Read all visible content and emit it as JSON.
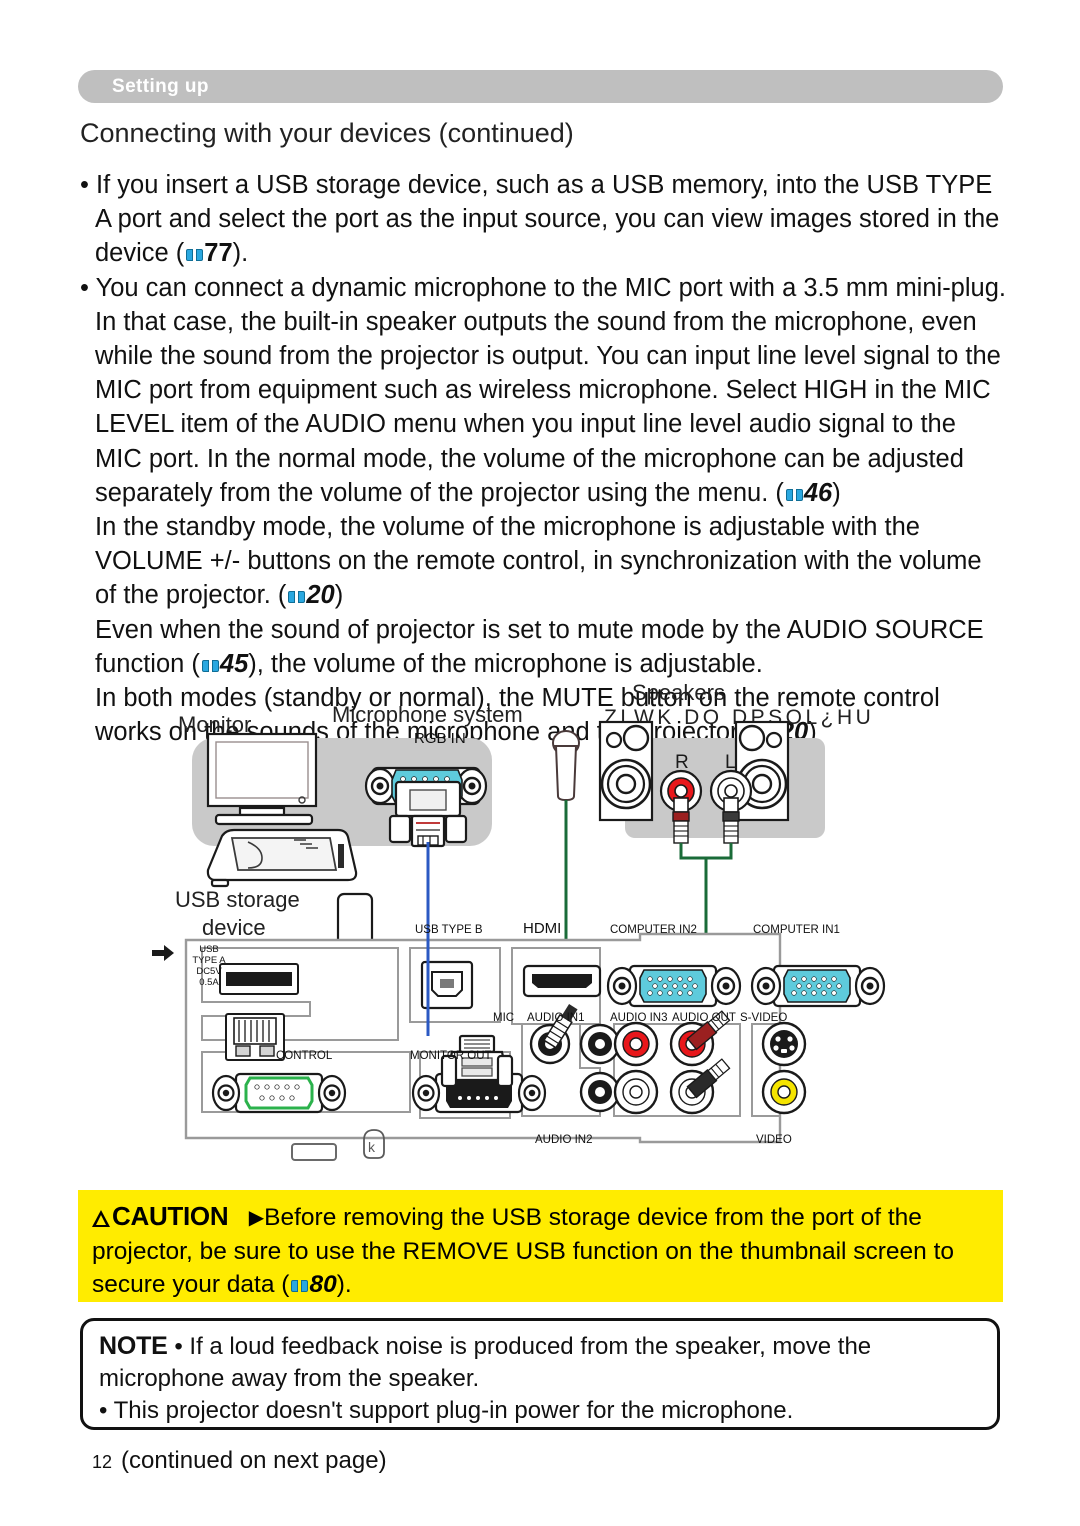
{
  "header": {
    "section_label": "Setting up",
    "title": "Connecting with your devices (continued)"
  },
  "body": {
    "bullet1_line1": "If you insert a USB storage device, such as a USB memory, into the USB TYPE",
    "bullet1_line2": "A port and select the port as the input source, you can view images stored in the",
    "bullet1_line3_pre": "device (",
    "bullet1_ref": "77",
    "bullet1_line3_post": ").",
    "bullet2_line1": "You can connect a dynamic microphone to the MIC port with a 3.5 mm mini-plug.",
    "bullet2_line2": "In that case, the built-in speaker outputs the sound from the microphone, even",
    "bullet2_line3": "while the sound from the projector is output. You can input line level signal to the",
    "bullet2_line4": "MIC port from equipment such as wireless microphone. Select HIGH in the MIC",
    "bullet2_line5": "LEVEL item of the AUDIO menu when you input line level audio signal to the",
    "bullet2_line6": "MIC port. In the normal mode, the volume of the microphone can be adjusted",
    "bullet2_line7_pre": "separately from the volume of the projector using the menu. (",
    "bullet2_ref1": "46",
    "bullet2_line7_post": ")",
    "bullet2_line8": "In the standby mode, the volume of the microphone is adjustable with the",
    "bullet2_line9": "VOLUME +/- buttons on the remote control, in synchronization with the volume",
    "bullet2_line10_pre": "of the projector. (",
    "bullet2_ref2": "20",
    "bullet2_line10_post": ")",
    "bullet2_line11": "Even when the sound of projector is set to mute mode by the AUDIO SOURCE",
    "bullet2_line12_pre": "function (",
    "bullet2_ref3": "45",
    "bullet2_line12_post": "), the  volume of the microphone is adjustable.",
    "bullet2_line13": "In both modes (standby or normal), the MUTE button on the remote control",
    "bullet2_line14_pre": "works on the sounds of the microphone and the projector. (",
    "bullet2_ref4": "20",
    "bullet2_line14_post": ")"
  },
  "diagram": {
    "device_labels": {
      "monitor": "Monitor",
      "microphone_system": "Microphone system",
      "speakers": "Speakers",
      "speakers_sub_garbled": "ZLWK DQ DPSOL¿HU",
      "usb_storage_line1": "USB storage",
      "usb_storage_line2": "device"
    },
    "speaker_channels": {
      "right": "R",
      "left": "L"
    },
    "usb_type_a_note": [
      "USB",
      "TYPE A",
      "DC5V",
      "0.5A"
    ],
    "port_labels": {
      "rgb_in": "RGB IN",
      "usb_type_b": "USB TYPE B",
      "hdmi": "HDMI",
      "computer_in2": "COMPUTER IN2",
      "computer_in1": "COMPUTER IN1",
      "mic": "MIC",
      "audio_in1": "AUDIO IN1",
      "audio_in3": "AUDIO IN3",
      "audio_out": "AUDIO OUT",
      "s_video": "S-VIDEO",
      "control": "CONTROL",
      "monitor_out": "MONITOR OUT",
      "audio_in2": "AUDIO IN2",
      "video": "VIDEO"
    },
    "colors": {
      "vga_blue": "#5ecbdc",
      "mic_cable_green": "#1a6b38",
      "rgb_cable_blue": "#2b59c3",
      "rca_red": "#e8171b",
      "rca_white": "#ffffff",
      "rca_yellow": "#f5e400",
      "control_green": "#2bb24c",
      "panel_gray": "#c9c9c9"
    }
  },
  "caution": {
    "label": "CAUTION",
    "arrow": "▶",
    "line1": "Before removing the USB storage device from the port of the",
    "line2": "projector, be sure to use the REMOVE USB function on the thumbnail screen to",
    "line3_pre": "secure your data (",
    "ref": "80",
    "line3_post": ").",
    "background_color": "#ffec00"
  },
  "note": {
    "label": "NOTE",
    "line1": "• If a loud feedback noise is produced from the speaker, move the",
    "line2": "microphone away from the speaker.",
    "line3": "• This projector doesn't support plug-in power for the microphone."
  },
  "footer": {
    "page_number": "12",
    "continued": "(continued on next page)"
  }
}
